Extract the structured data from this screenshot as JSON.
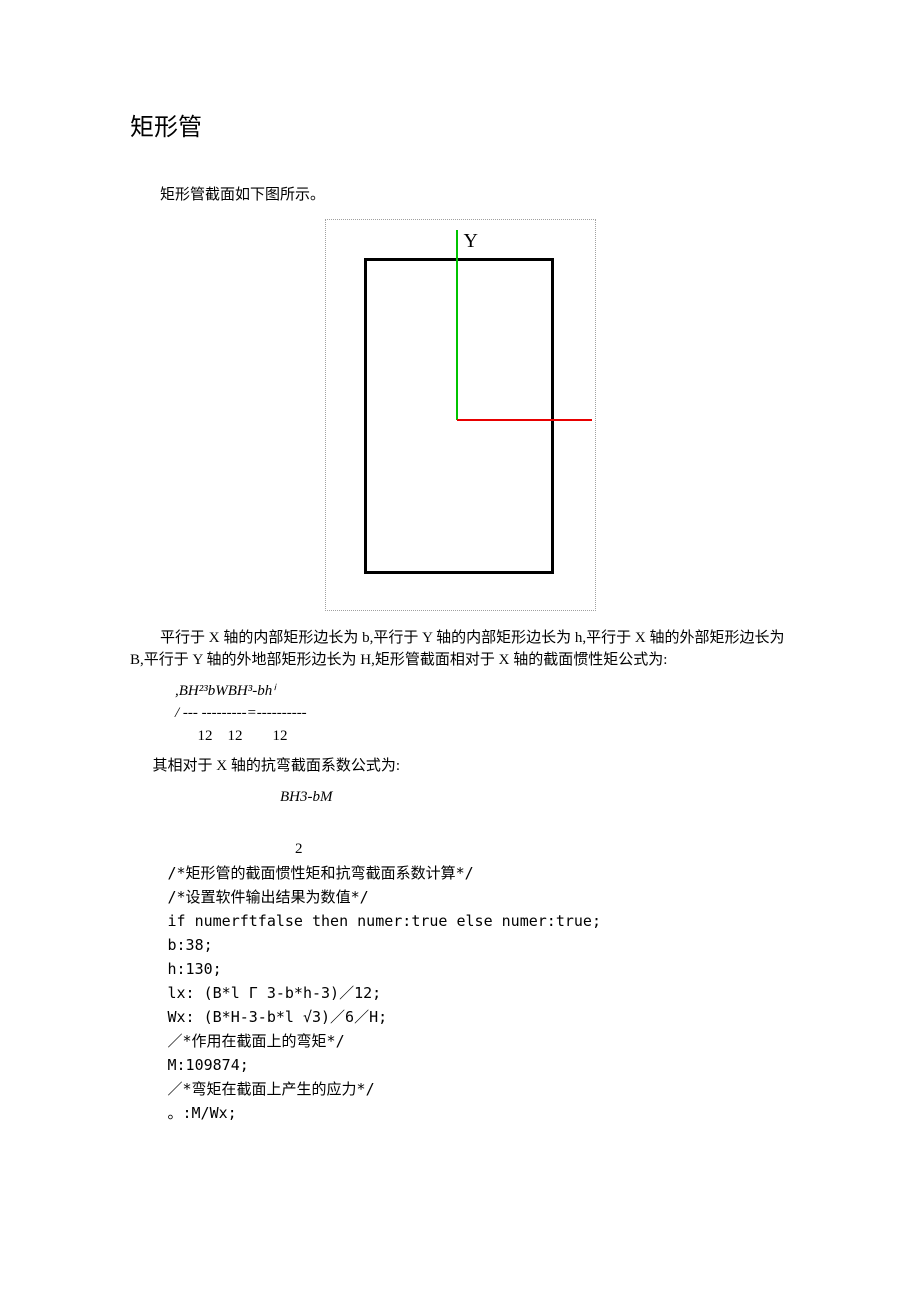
{
  "title": "矩形管",
  "intro": "矩形管截面如下图所示。",
  "diagram": {
    "y_label": "Y"
  },
  "para_desc": "平行于 X 轴的内部矩形边长为 b,平行于 Y 轴的内部矩形边长为 h,平行于 X 轴的外部矩形边长为 B,平行于 Y 轴的外地部矩形边长为 H,矩形管截面相对于 X 轴的截面惯性矩公式为:",
  "formula1": {
    "line1": ",BH²³bWBH³-bhⁱ",
    "line2": "/ --- ---------=----------",
    "line3": "      12    12        12"
  },
  "para_wx": "其相对于 X 轴的抗弯截面系数公式为:",
  "formula2": {
    "line1": "BH3-bM"
  },
  "big2": "2",
  "code": {
    "l1": "/*矩形管的截面惯性矩和抗弯截面系数计算*/",
    "l2": "/*设置软件输出结果为数值*/",
    "l3": "if numerftfalse then numer:true else numer:true;",
    "l4": "b:38;",
    "l5": "h:130;",
    "l6": "lx: (B*l Γ 3-b*h-3)／12;",
    "l7": "Wx: (B*H-3-b*l √3)／6／H;",
    "l8": "／*作用在截面上的弯矩*/",
    "l9": "M:109874;",
    "l10": "／*弯矩在截面上产生的应力*/",
    "l11": "。:M/Wx;"
  }
}
